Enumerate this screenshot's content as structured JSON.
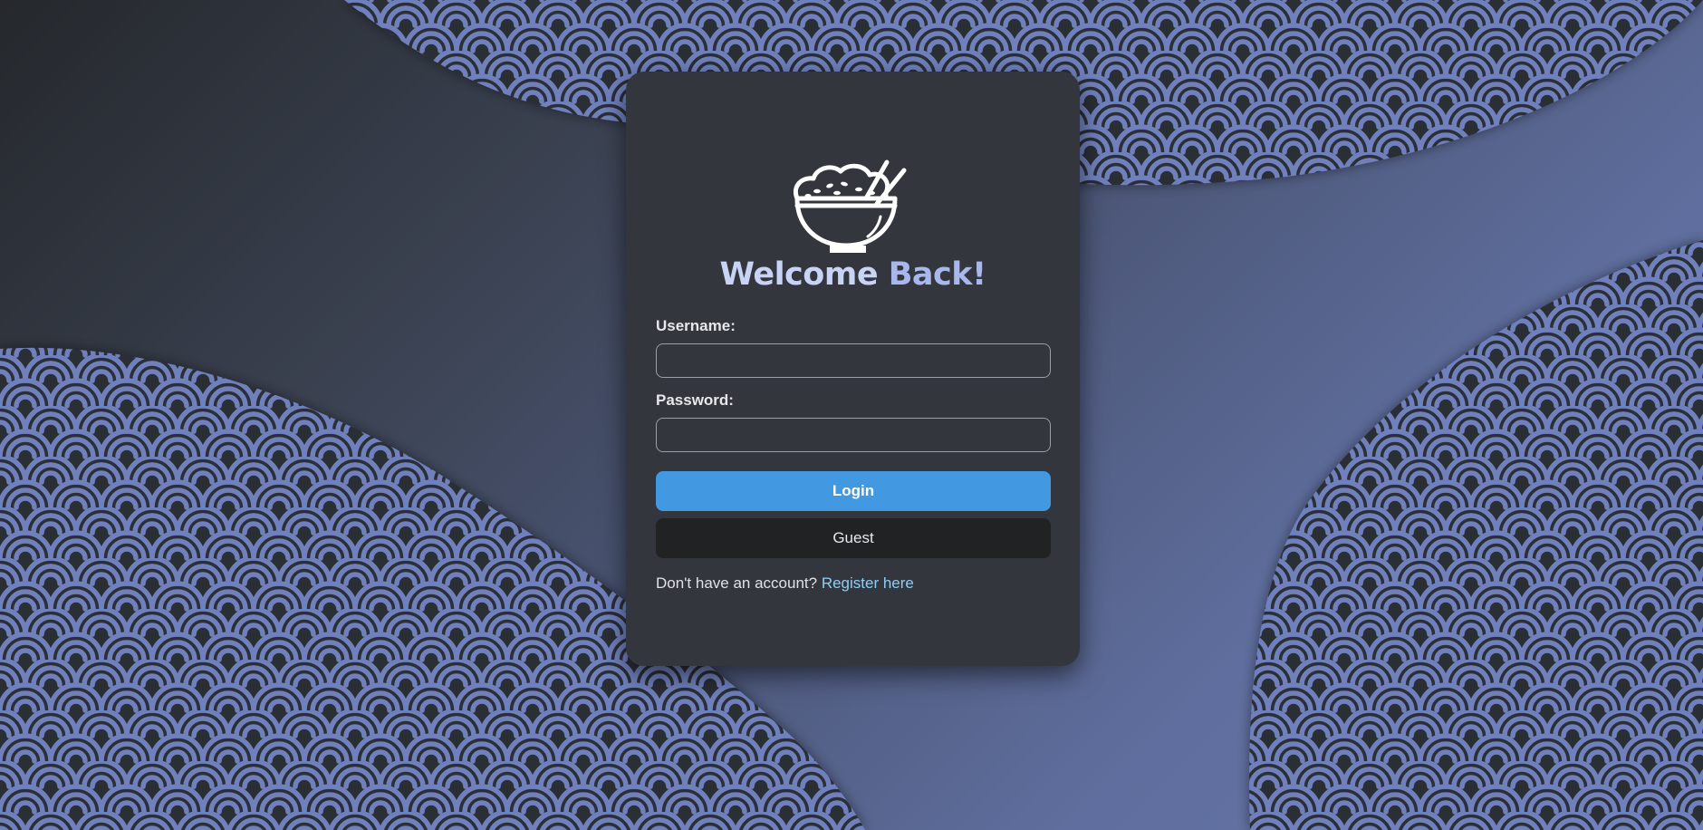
{
  "app": {
    "heading_word1": "Welcome",
    "heading_word2": "Back!"
  },
  "form": {
    "username_label": "Username:",
    "username_value": "",
    "password_label": "Password:",
    "password_value": "",
    "login_label": "Login",
    "guest_label": "Guest",
    "register_prompt": "Don't have an account?",
    "register_link": "Register here"
  },
  "icons": {
    "logo": "rice-bowl-with-chopsticks-icon"
  },
  "colors": {
    "login_button": "#4299e1",
    "guest_button": "#212224",
    "card": "#33363c",
    "link": "#90cdf4",
    "heading": "#b7c5f0",
    "pattern_light": "#6f80bd",
    "pattern_dark": "#2b2f36"
  }
}
